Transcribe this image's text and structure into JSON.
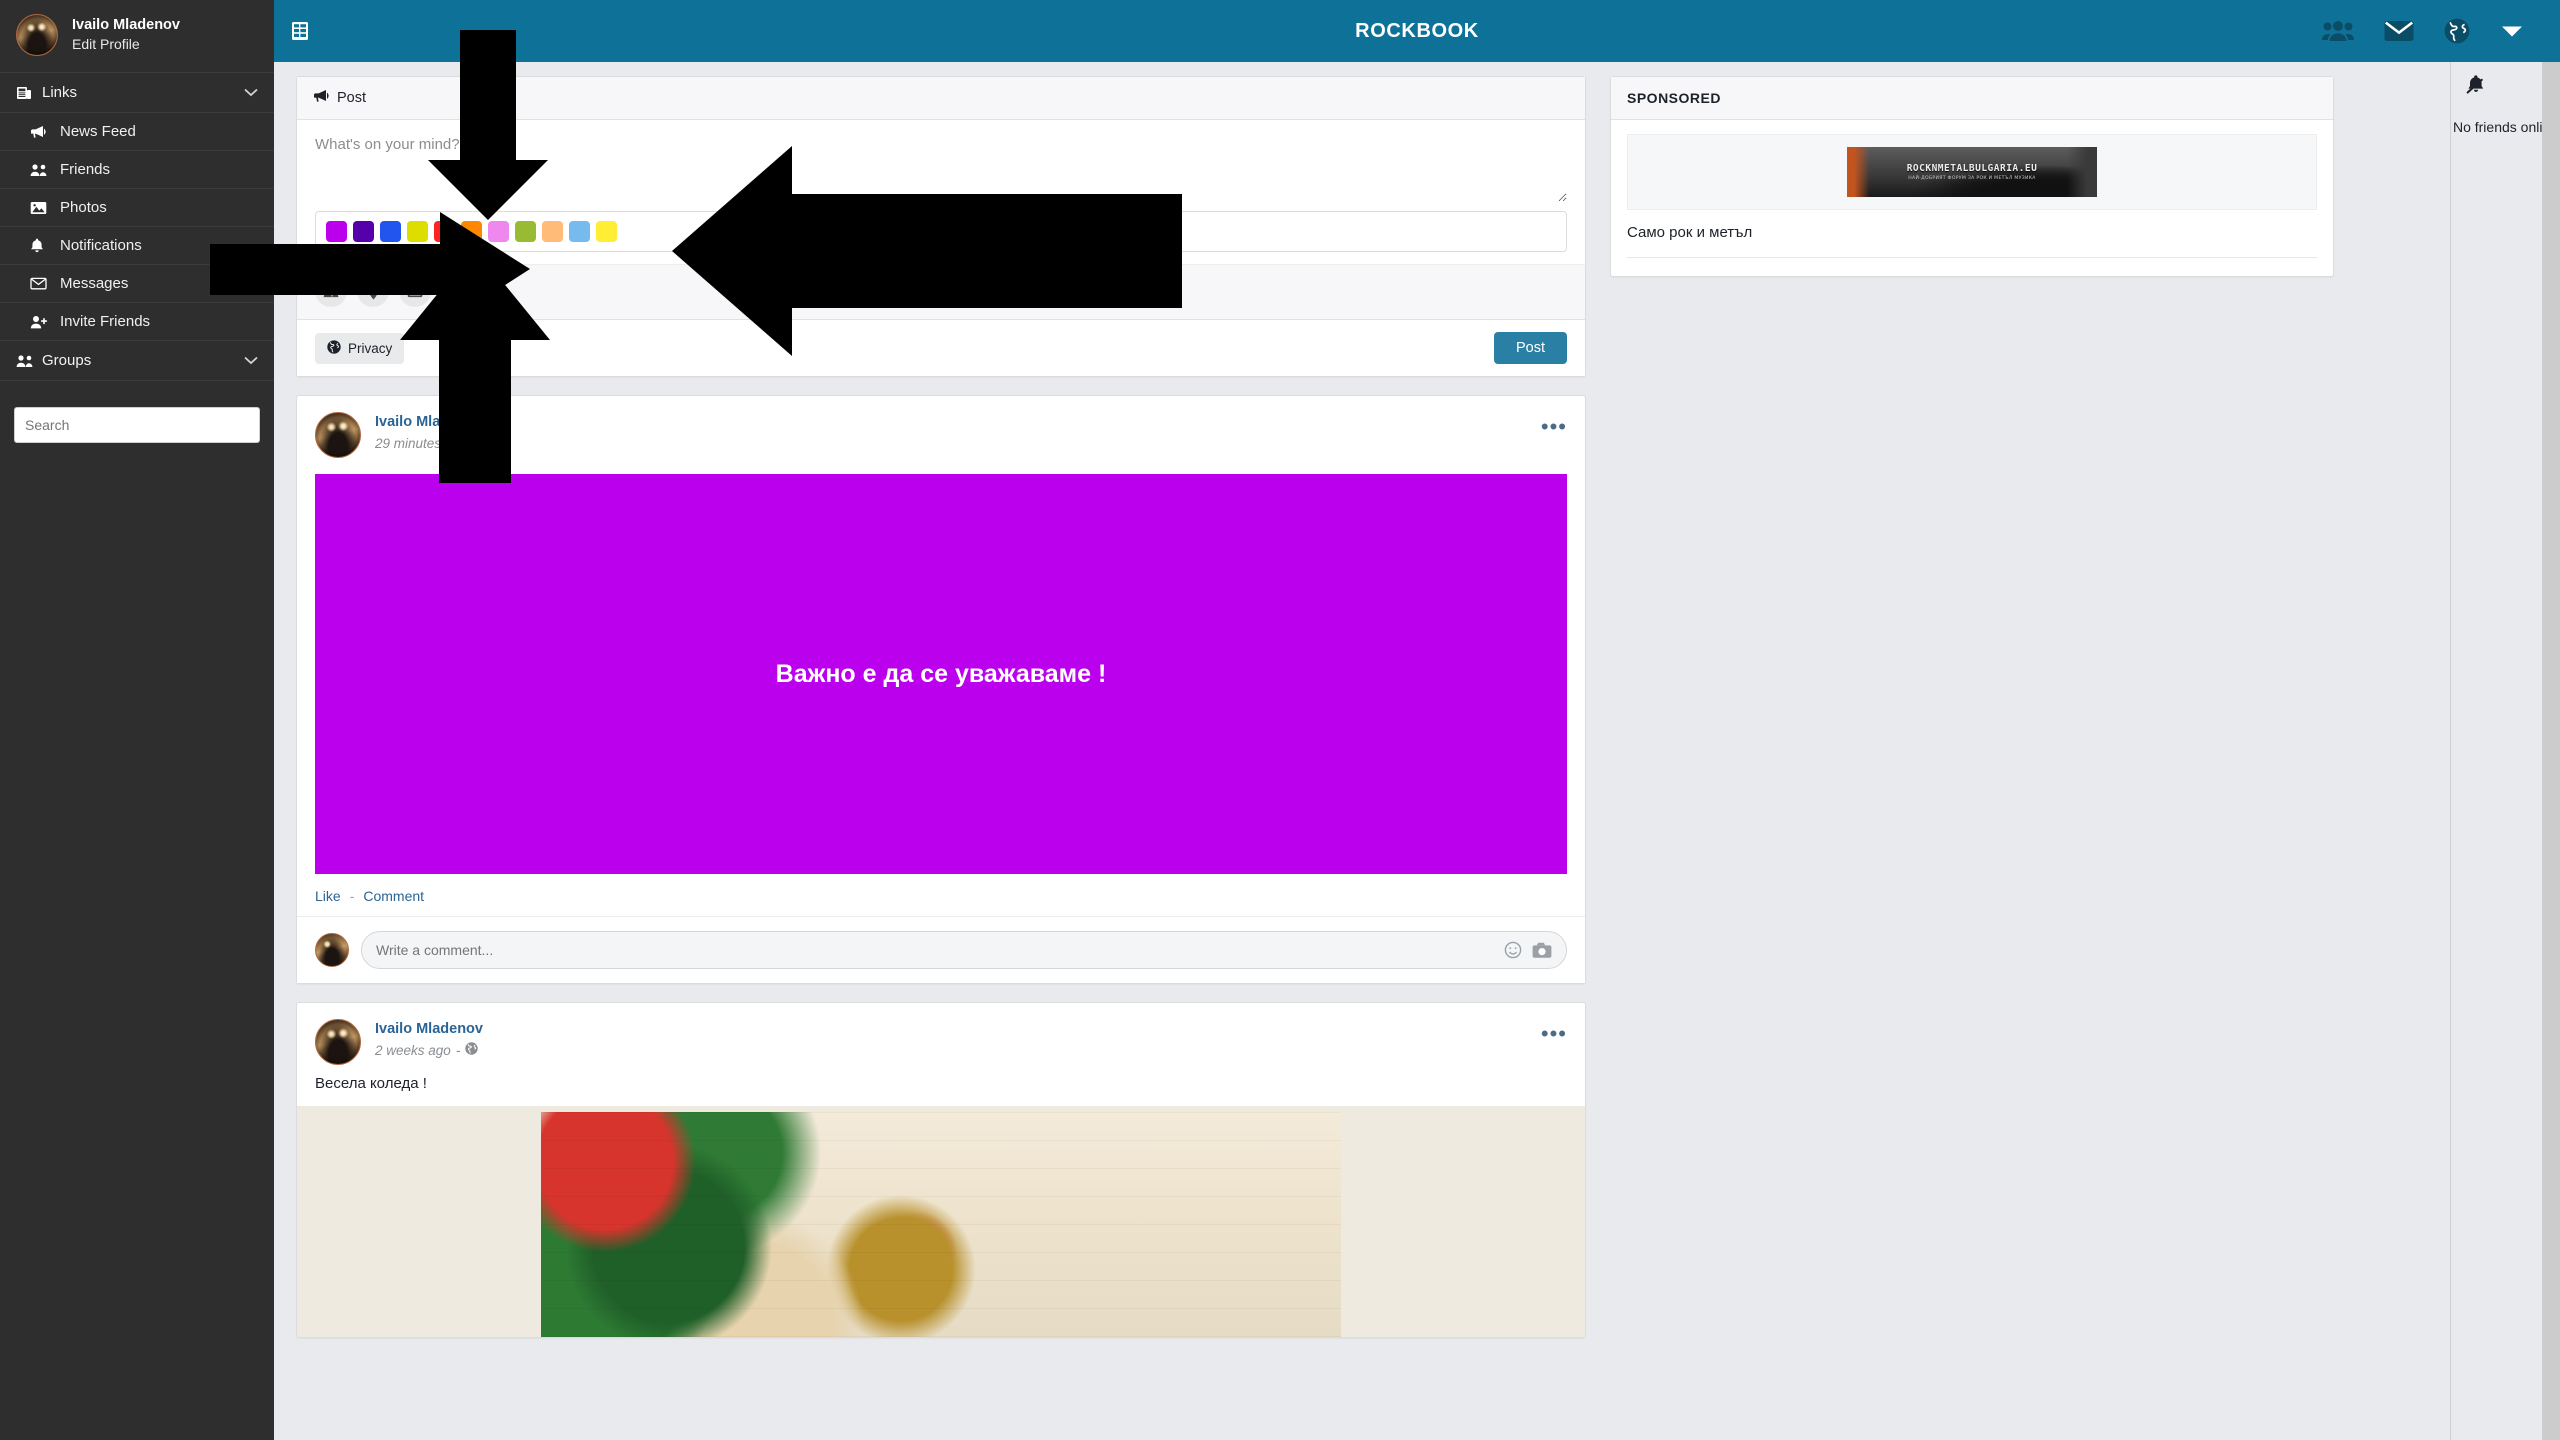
{
  "sidebar": {
    "profile": {
      "name": "Ivailo Mladenov",
      "edit": "Edit Profile",
      "avatar_icon": "user-avatar"
    },
    "group_label": "Links",
    "group_icon": "newspaper-icon",
    "items": [
      {
        "label": "News Feed",
        "icon": "megaphone-icon"
      },
      {
        "label": "Friends",
        "icon": "friends-icon"
      },
      {
        "label": "Photos",
        "icon": "photo-icon"
      },
      {
        "label": "Notifications",
        "icon": "bell-icon"
      },
      {
        "label": "Messages",
        "icon": "envelope-icon"
      },
      {
        "label": "Invite Friends",
        "icon": "user-plus-icon"
      }
    ],
    "groups_label": "Groups",
    "groups_icon": "friends-icon",
    "search_placeholder": "Search",
    "search_value": ""
  },
  "topbar": {
    "brand": "ROCKBOOK",
    "menu_icon": "list-menu-icon",
    "actions": [
      {
        "icon": "friends-icon",
        "name": "friend-requests"
      },
      {
        "icon": "envelope-icon",
        "name": "messages"
      },
      {
        "icon": "globe-icon",
        "name": "notifications"
      },
      {
        "icon": "caret-down-icon",
        "name": "account-menu"
      }
    ]
  },
  "composer": {
    "title": "Post",
    "title_icon": "megaphone-icon",
    "placeholder": "What's on your mind?",
    "value": "",
    "palette": [
      "#bb00ee",
      "#5500aa",
      "#2255ee",
      "#dddd00",
      "#ff2222",
      "#ff8800",
      "#ee88ee",
      "#99bb33",
      "#ffbb77",
      "#77bbee",
      "#ffee33"
    ],
    "tools": [
      {
        "icon": "tag-friends-icon",
        "name": "tag-friends"
      },
      {
        "icon": "location-pin-icon",
        "name": "check-in"
      },
      {
        "icon": "photo-icon",
        "name": "add-photo"
      },
      {
        "icon": "paint-brush-icon",
        "name": "background-color"
      }
    ],
    "privacy_label": "Privacy",
    "privacy_icon": "globe-icon",
    "post_label": "Post"
  },
  "feed": [
    {
      "author": "Ivailo Mladenov",
      "time": "29 minutes ago",
      "privacy_icon": "globe-icon",
      "more_icon": "ellipsis-icon",
      "more_label": "•••",
      "body_type": "color",
      "body_color": "#bb00ee",
      "body_text": "Важно е да се уважаваме !",
      "like_label": "Like",
      "comment_label": "Comment",
      "separator": "-",
      "comment_placeholder": "Write a comment...",
      "comment_value": "",
      "emoji_icon": "smiley-icon",
      "camera_icon": "camera-icon"
    },
    {
      "author": "Ivailo Mladenov",
      "time": "2 weeks ago",
      "privacy_icon": "globe-icon",
      "more_icon": "ellipsis-icon",
      "more_label": "•••",
      "body_type": "image",
      "body_text": "Весела коледа !",
      "image_alt": "christmas-ornaments-photo"
    }
  ],
  "sponsored": {
    "title": "SPONSORED",
    "banner_line1": "ROCKNMETALBULGARIA.EU",
    "banner_line2": "НАЙ-ДОБРИЯТ ФОРУМ ЗА РОК И МЕТЪЛ МУЗИКА",
    "caption": "Само рок и метъл"
  },
  "chat": {
    "mute_icon": "bell-slash-icon",
    "empty_text": "No friends online"
  },
  "colors": {
    "brand_blue": "#0e7298",
    "sidebar_bg": "#2e2e2e",
    "page_bg": "#e9eaed",
    "link_blue": "#2a6496",
    "post_button": "#2a7fa5"
  },
  "overlays": {
    "arrows": [
      {
        "name": "down-arrow-composer",
        "direction": "down"
      },
      {
        "name": "left-arrow-palette",
        "direction": "left"
      },
      {
        "name": "up-arrow-palette",
        "direction": "up"
      },
      {
        "name": "right-arrow-sidebar",
        "direction": "right"
      }
    ]
  }
}
